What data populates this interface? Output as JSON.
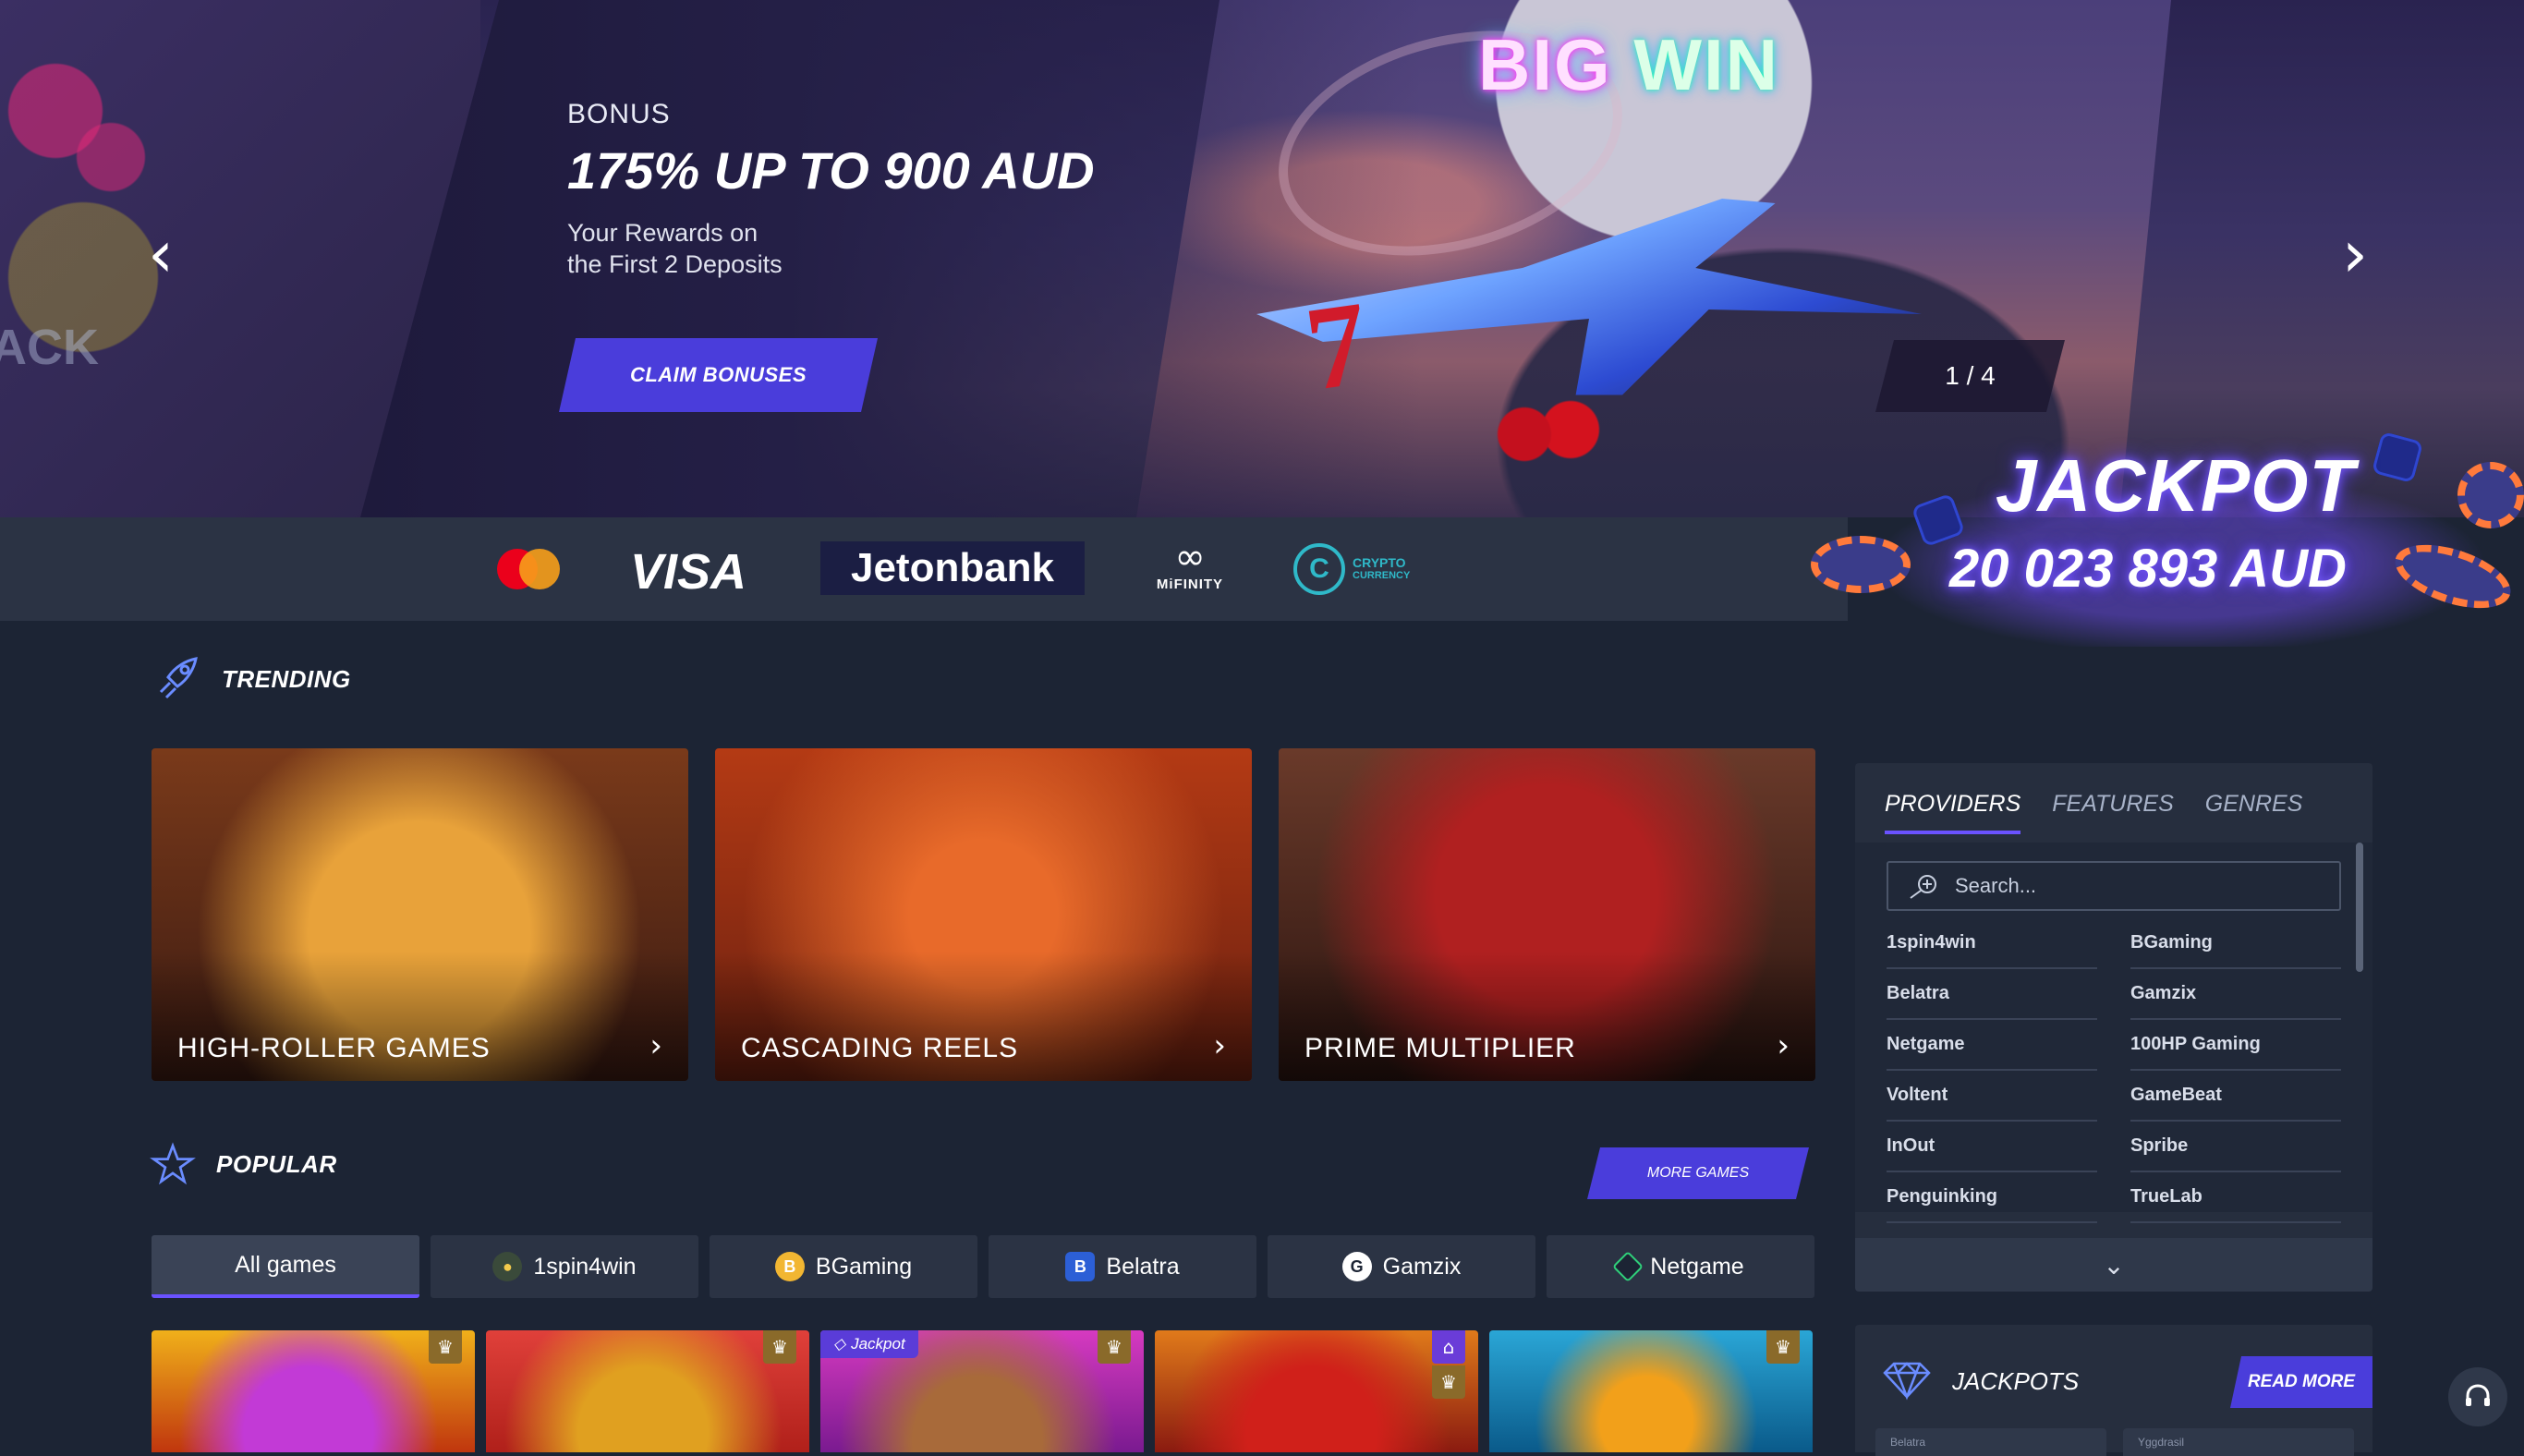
{
  "hero": {
    "label": "BONUS",
    "title": "175% UP TO 900 AUD",
    "subtitle_line1": "Your Rewards on",
    "subtitle_line2": "the First 2 Deposits",
    "cta": "CLAIM BONUSES",
    "slide_counter": "1 / 4",
    "art_text_big": "BIG",
    "art_text_win": "WIN",
    "left_art_text": "ACK"
  },
  "payments": {
    "visa": "VISA",
    "jetonbank": "Jetonbank",
    "mifinity": "MiFINITY",
    "crypto_line1": "CRYPTO",
    "crypto_line2": "CURRENCY",
    "crypto_symbol": "C"
  },
  "jackpot_banner": {
    "title": "JACKPOT",
    "amount": "20 023 893 AUD"
  },
  "trending": {
    "heading": "TRENDING",
    "cards": [
      {
        "title": "HIGH-ROLLER GAMES"
      },
      {
        "title": "CASCADING REELS"
      },
      {
        "title": "PRIME MULTIPLIER"
      }
    ]
  },
  "providers_panel": {
    "tabs": [
      "PROVIDERS",
      "FEATURES",
      "GENRES"
    ],
    "search_placeholder": "Search...",
    "left_column": [
      "1spin4win",
      "Belatra",
      "Netgame",
      "Voltent",
      "InOut",
      "Penguinking"
    ],
    "right_column": [
      "BGaming",
      "Gamzix",
      "100HP Gaming",
      "GameBeat",
      "Spribe",
      "TrueLab"
    ]
  },
  "popular": {
    "heading": "POPULAR",
    "more_games": "MORE GAMES",
    "filters": [
      {
        "label": "All games"
      },
      {
        "label": "1spin4win"
      },
      {
        "label": "BGaming"
      },
      {
        "label": "Belatra"
      },
      {
        "label": "Gamzix"
      },
      {
        "label": "Netgame"
      }
    ],
    "jackpot_badge": "Jackpot"
  },
  "jackpots_panel": {
    "heading": "JACKPOTS",
    "read_more": "READ MORE",
    "cards": [
      "Belatra",
      "Yggdrasil"
    ]
  },
  "colors": {
    "accent": "#4a3ddb",
    "background": "#1c2434",
    "panel": "#262e3e"
  }
}
